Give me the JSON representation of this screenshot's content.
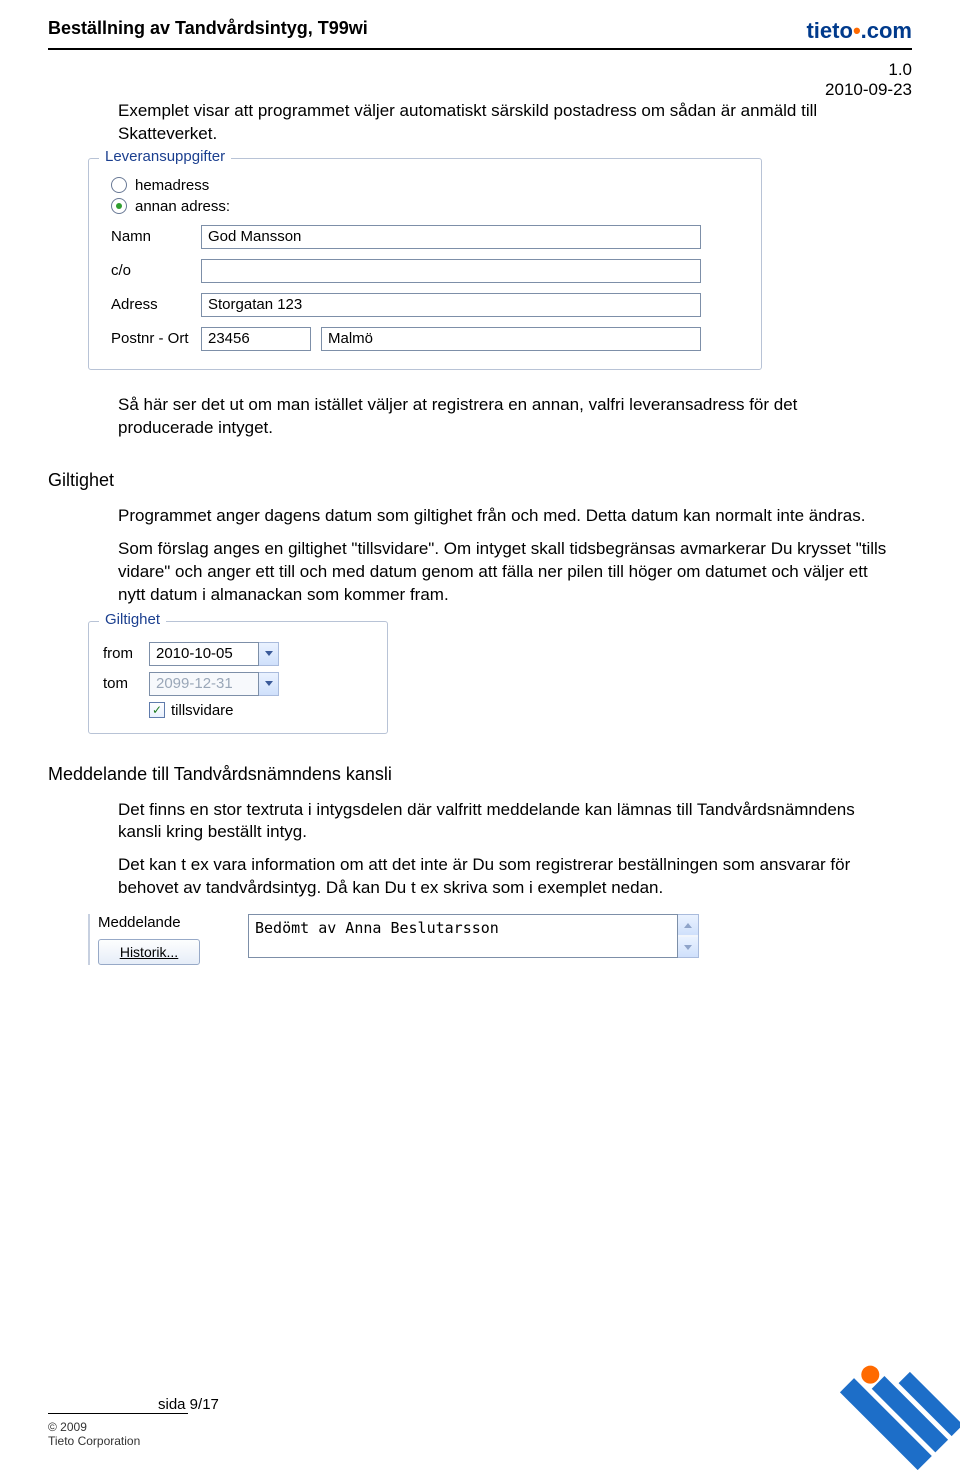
{
  "header": {
    "title": "Beställning av Tandvårdsintyg, T99wi",
    "brand_primary": "tieto",
    "brand_suffix": ".com",
    "version": "1.0",
    "date": "2010-09-23"
  },
  "intro": {
    "p1": "Exemplet visar att programmet väljer automatiskt särskild postadress om sådan är anmäld till Skatteverket."
  },
  "leverans": {
    "legend": "Leveransuppgifter",
    "radio_hem": "hemadress",
    "radio_annan": "annan adress:",
    "label_namn": "Namn",
    "val_namn": "God Mansson",
    "label_co": "c/o",
    "val_co": "",
    "label_adress": "Adress",
    "val_adress": "Storgatan 123",
    "label_postnr": "Postnr - Ort",
    "val_postnr": "23456",
    "val_ort": "Malmö"
  },
  "after_panel": {
    "p1": "Så här ser det ut om man istället väljer at registrera en annan, valfri leveransadress för det producerade intyget."
  },
  "giltighet": {
    "heading": "Giltighet",
    "p1": "Programmet anger dagens datum som giltighet från och med. Detta datum kan normalt inte ändras.",
    "p2": "Som förslag anges en giltighet \"tillsvidare\". Om intyget skall tidsbegränsas avmarkerar Du krysset \"tills vidare\" och anger ett till och med datum genom att fälla ner pilen till höger om datumet och väljer ett nytt datum i almanackan som kommer fram.",
    "legend": "Giltighet",
    "label_from": "from",
    "val_from": "2010-10-05",
    "label_tom": "tom",
    "val_tom": "2099-12-31",
    "chk_label": "tillsvidare"
  },
  "medd": {
    "heading": "Meddelande till Tandvårdsnämndens kansli",
    "p1": "Det finns en stor textruta i intygsdelen där valfritt meddelande kan lämnas till Tandvårdsnämndens kansli kring beställt intyg.",
    "p2": "Det kan t ex vara information om att det inte är Du som registrerar beställningen som ansvarar för behovet av tandvårdsintyg. Då kan Du t ex skriva som i exemplet nedan.",
    "label": "Meddelande",
    "historik_btn": "Historik...",
    "textarea_val": "Bedömt av Anna Beslutarsson"
  },
  "footer": {
    "copyright": "© 2009",
    "company": "Tieto Corporation",
    "page": "sida 9/17"
  }
}
